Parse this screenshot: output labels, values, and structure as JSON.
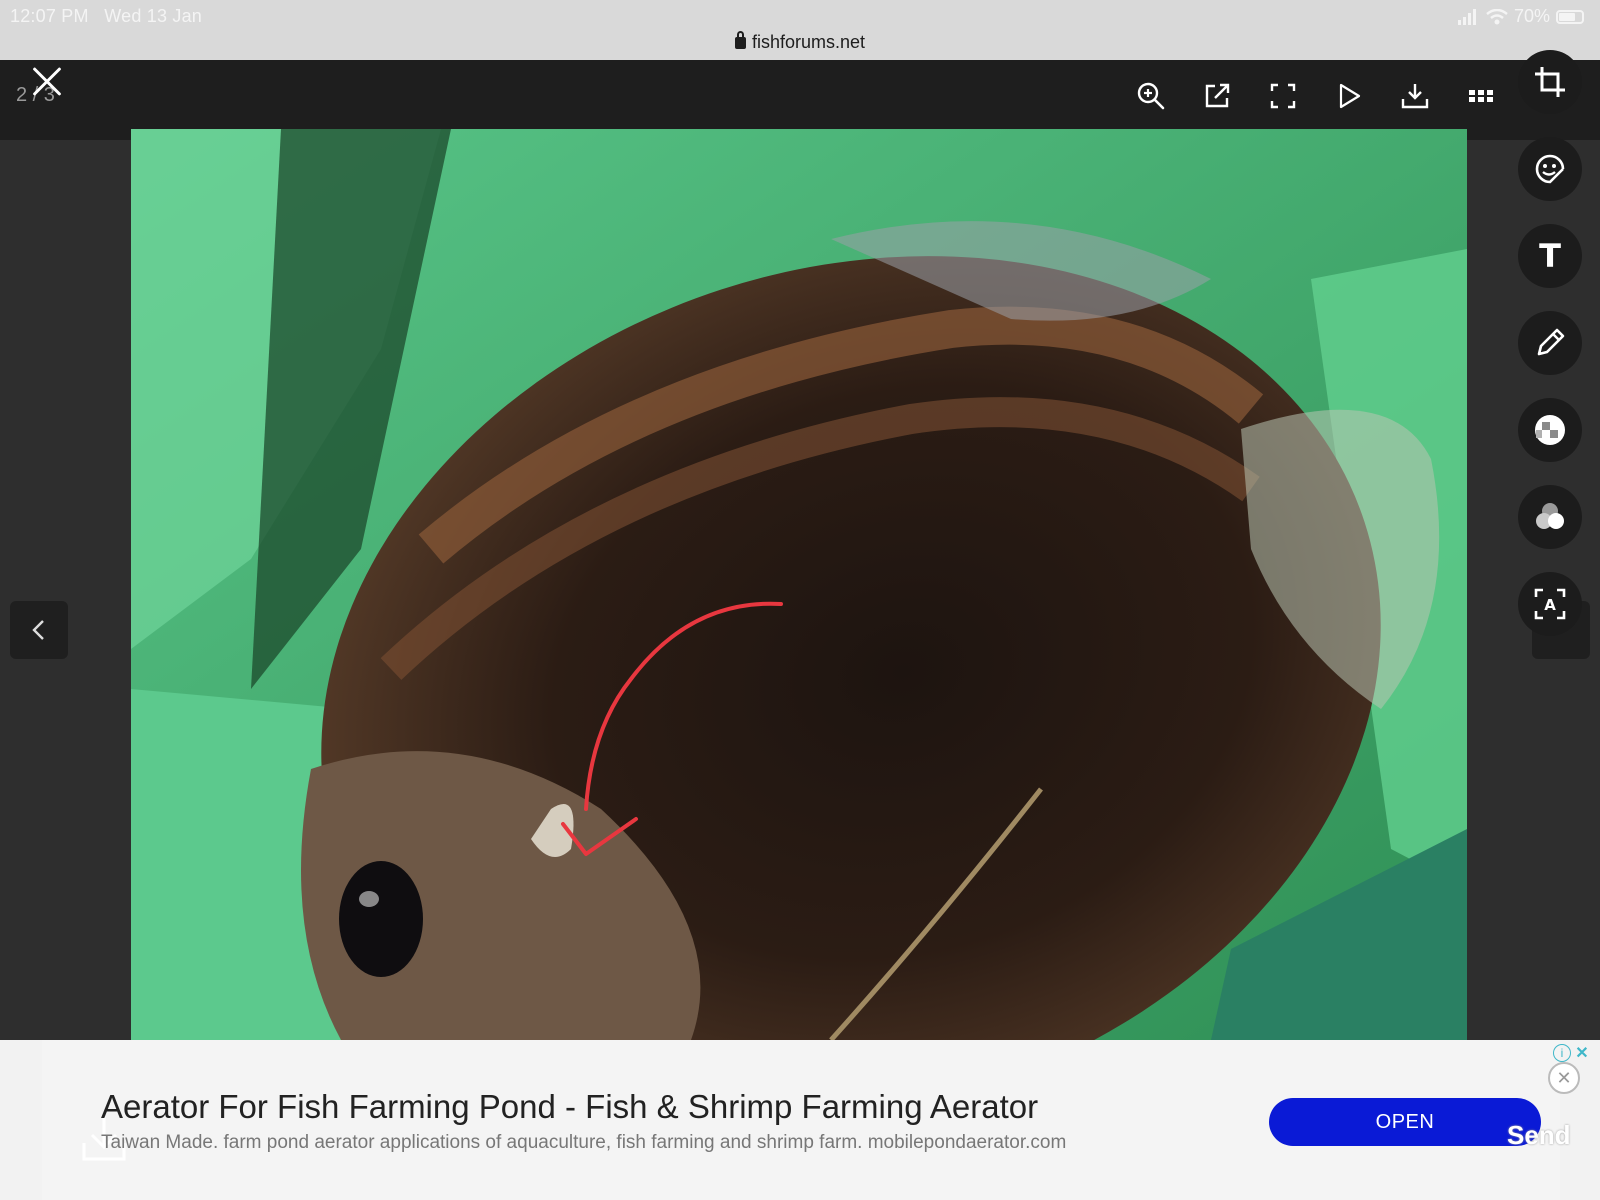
{
  "status_bar": {
    "time": "12:07 PM",
    "date": "Wed 13 Jan",
    "battery": "70%",
    "url": "fishforums.net"
  },
  "viewer": {
    "counter": "2 / 3",
    "toolbar_icons": [
      "zoom-in-icon",
      "share-icon",
      "fullscreen-icon",
      "play-icon",
      "download-icon",
      "grid-icon"
    ],
    "side_tools": [
      "crop-icon",
      "sticker-icon",
      "text-icon",
      "pencil-icon",
      "mosaic-icon",
      "filter-icon",
      "text-recognition-icon"
    ],
    "text_tool_letter": "T",
    "ocr_letter": "A"
  },
  "ad": {
    "title": "Aerator For Fish Farming Pond - Fish & Shrimp Farming Aerator",
    "description": "Taiwan Made. farm pond aerator applications of aquaculture, fish farming and shrimp farm. mobilepondaerator.com",
    "open_label": "OPEN",
    "send_label": "Send",
    "close_glyph": "✕",
    "info_glyph": "i",
    "choices_close_glyph": "✕"
  },
  "colors": {
    "open_button": "#0a1ad6",
    "annotation": "#e8373f"
  }
}
